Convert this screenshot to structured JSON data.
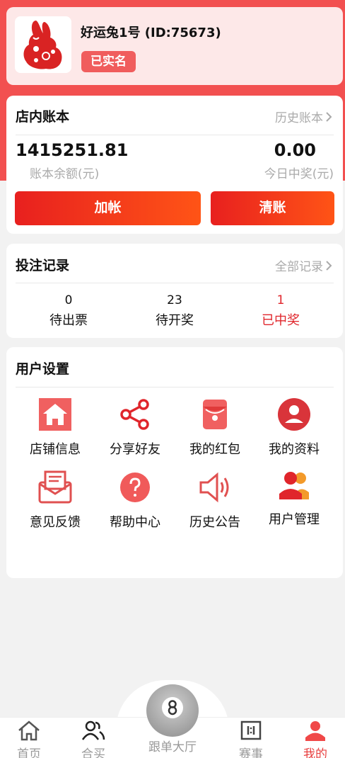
{
  "profile": {
    "name": "好运兔1号 (ID:75673)",
    "verified_badge": "已实名",
    "avatar_icon": "rabbit-papercut-icon"
  },
  "ledger": {
    "title": "店内账本",
    "history_link": "历史账本",
    "balance": "1415251.81",
    "balance_label": "账本余额(元)",
    "today_win": "0.00",
    "today_win_label": "今日中奖(元)",
    "add_button": "加帐",
    "clear_button": "清账"
  },
  "bets": {
    "title": "投注记录",
    "all_link": "全部记录",
    "stats": [
      {
        "count": "0",
        "label": "待出票"
      },
      {
        "count": "23",
        "label": "待开奖"
      },
      {
        "count": "1",
        "label": "已中奖"
      }
    ]
  },
  "settings": {
    "title": "用户设置",
    "items": [
      {
        "label": "店铺信息",
        "icon": "shop-home-icon"
      },
      {
        "label": "分享好友",
        "icon": "share-icon"
      },
      {
        "label": "我的红包",
        "icon": "red-packet-icon"
      },
      {
        "label": "我的资料",
        "icon": "profile-icon"
      },
      {
        "label": "意见反馈",
        "icon": "feedback-mail-icon"
      },
      {
        "label": "帮助中心",
        "icon": "help-icon"
      },
      {
        "label": "历史公告",
        "icon": "announcement-speaker-icon"
      },
      {
        "label": "用户管理",
        "icon": "user-management-icon"
      }
    ]
  },
  "tabbar": {
    "items": [
      {
        "label": "首页",
        "icon": "home-icon"
      },
      {
        "label": "合买",
        "icon": "group-buy-icon"
      },
      {
        "label": "跟单大厅",
        "icon": "eight-ball-icon"
      },
      {
        "label": "赛事",
        "icon": "scoreboard-icon"
      },
      {
        "label": "我的",
        "icon": "user-icon"
      }
    ],
    "active": "我的"
  },
  "colors": {
    "header_red": "#f25050",
    "accent_red": "#e8201f",
    "orange": "#ff5416",
    "muted_gray": "#aaaaaa"
  }
}
